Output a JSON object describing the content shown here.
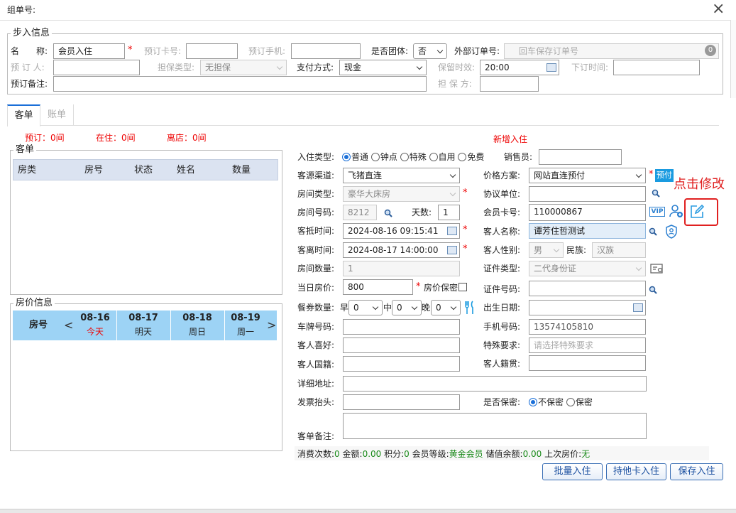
{
  "dialog": {
    "title": "组单号:",
    "close": "×"
  },
  "booking": {
    "legend": "步入信息",
    "name_label": "名　　称:",
    "name_value": "会员入住",
    "card_label": "预订卡号:",
    "phone_label": "预订手机:",
    "group_label": "是否团体:",
    "group_value": "否",
    "ext_label": "外部订单号:",
    "ext_placeholder": "回车保存订单号",
    "ext_badge": "0",
    "person_label": "预 订 人:",
    "guarantee_type_label": "担保类型:",
    "guarantee_type_value": "无担保",
    "pay_label": "支付方式:",
    "pay_value": "现金",
    "retain_label": "保留时效:",
    "retain_value": "20:00",
    "order_time_label": "下订时间:",
    "remark_label": "预订备注:",
    "guarantor_label": "担 保 方:"
  },
  "tabs": [
    {
      "label": "客单"
    },
    {
      "label": "账单"
    }
  ],
  "stats": {
    "reserved": "预订：0间",
    "staying": "在住：0间",
    "left": "离店：0间"
  },
  "guest_list": {
    "legend": "客单",
    "columns": [
      "房类",
      "房号",
      "状态",
      "姓名",
      "数量"
    ]
  },
  "price_info": {
    "legend": "房价信息",
    "room_col": "房号",
    "prev": "<",
    "next": ">",
    "days": [
      {
        "date": "08-16",
        "label": "今天",
        "today": true
      },
      {
        "date": "08-17",
        "label": "明天"
      },
      {
        "date": "08-18",
        "label": "周日"
      },
      {
        "date": "08-19",
        "label": "周一"
      }
    ]
  },
  "form": {
    "heading": "新增入住",
    "checkin_type_label": "入住类型:",
    "checkin_types": [
      "普通",
      "钟点",
      "特殊",
      "自用",
      "免费"
    ],
    "sales_label": "销售员:",
    "channel_label": "客源渠道:",
    "channel_value": "飞猪直连",
    "price_plan_label": "价格方案:",
    "price_plan_value": "网站直连预付",
    "prepaid_badge": "预付",
    "room_type_label": "房间类型:",
    "room_type_value": "豪华大床房",
    "agreement_label": "协议单位:",
    "room_no_label": "房间号码:",
    "room_no_value": "8212",
    "days_label": "天数:",
    "days_value": "1",
    "member_card_label": "会员卡号:",
    "member_card_value": "110000867",
    "vip_badge": "VIP",
    "arrive_label": "客抵时间:",
    "arrive_value": "2024-08-16 09:15:41",
    "guest_name_label": "客人名称:",
    "guest_name_value": "谭芳住哲测试",
    "depart_label": "客离时间:",
    "depart_value": "2024-08-17 14:00:00",
    "gender_label": "客人性别:",
    "gender_value": "男",
    "ethnic_label": "民族:",
    "ethnic_value": "汉族",
    "room_count_label": "房间数量:",
    "room_count_value": "1",
    "id_type_label": "证件类型:",
    "id_type_value": "二代身份证",
    "day_price_label": "当日房价:",
    "day_price_value": "800",
    "price_secret_label": "房价保密",
    "id_no_label": "证件号码:",
    "meal_label": "餐券数量:",
    "breakfast": "早",
    "lunch": "中",
    "dinner": "晚",
    "meal_values": [
      "0",
      "0",
      "0"
    ],
    "birth_label": "出生日期:",
    "plate_label": "车牌号码:",
    "mobile_label": "手机号码:",
    "mobile_value": "13574105810",
    "hobby_label": "客人喜好:",
    "special_label": "特殊要求:",
    "special_placeholder": "请选择特殊要求",
    "nationality_label": "客人国籍:",
    "native_label": "客人籍贯:",
    "address_label": "详细地址:",
    "invoice_label": "发票抬头:",
    "secret_label": "是否保密:",
    "secret_options": [
      "不保密",
      "保密"
    ],
    "remark_label": "客单备注:"
  },
  "summary": {
    "visits_label": "消费次数:",
    "visits": "0",
    "amount_label": "金额:",
    "amount": "0.00",
    "points_label": "积分:",
    "points": "0",
    "level_label": "会员等级:",
    "level": "黄金会员",
    "balance_label": "储值余额:",
    "balance": "0.00",
    "last_price_label": "上次房价:",
    "last_price": "无"
  },
  "buttons": {
    "batch": "批量入住",
    "other_card": "持他卡入住",
    "save": "保存入住"
  },
  "annotation": {
    "text": "点击修改"
  },
  "colors": {
    "accent": "#1a6fd8",
    "red": "#e00000",
    "table_header": "#dbe3f1",
    "price_header": "#9dd3f5",
    "annotation": "#e02020"
  }
}
